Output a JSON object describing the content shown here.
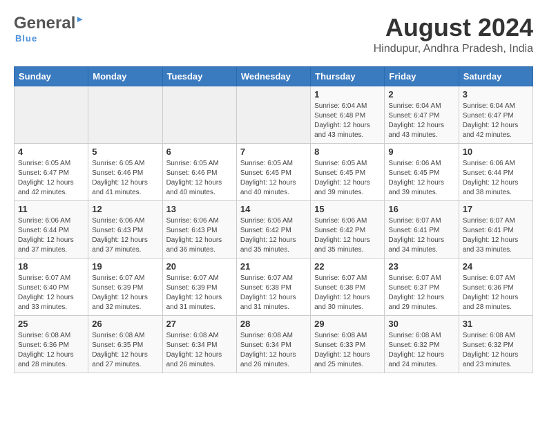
{
  "header": {
    "logo_general": "General",
    "logo_blue": "Blue",
    "month_year": "August 2024",
    "location": "Hindupur, Andhra Pradesh, India"
  },
  "calendar": {
    "weekdays": [
      "Sunday",
      "Monday",
      "Tuesday",
      "Wednesday",
      "Thursday",
      "Friday",
      "Saturday"
    ],
    "weeks": [
      [
        {
          "day": "",
          "info": ""
        },
        {
          "day": "",
          "info": ""
        },
        {
          "day": "",
          "info": ""
        },
        {
          "day": "",
          "info": ""
        },
        {
          "day": "1",
          "info": "Sunrise: 6:04 AM\nSunset: 6:48 PM\nDaylight: 12 hours\nand 43 minutes."
        },
        {
          "day": "2",
          "info": "Sunrise: 6:04 AM\nSunset: 6:47 PM\nDaylight: 12 hours\nand 43 minutes."
        },
        {
          "day": "3",
          "info": "Sunrise: 6:04 AM\nSunset: 6:47 PM\nDaylight: 12 hours\nand 42 minutes."
        }
      ],
      [
        {
          "day": "4",
          "info": "Sunrise: 6:05 AM\nSunset: 6:47 PM\nDaylight: 12 hours\nand 42 minutes."
        },
        {
          "day": "5",
          "info": "Sunrise: 6:05 AM\nSunset: 6:46 PM\nDaylight: 12 hours\nand 41 minutes."
        },
        {
          "day": "6",
          "info": "Sunrise: 6:05 AM\nSunset: 6:46 PM\nDaylight: 12 hours\nand 40 minutes."
        },
        {
          "day": "7",
          "info": "Sunrise: 6:05 AM\nSunset: 6:45 PM\nDaylight: 12 hours\nand 40 minutes."
        },
        {
          "day": "8",
          "info": "Sunrise: 6:05 AM\nSunset: 6:45 PM\nDaylight: 12 hours\nand 39 minutes."
        },
        {
          "day": "9",
          "info": "Sunrise: 6:06 AM\nSunset: 6:45 PM\nDaylight: 12 hours\nand 39 minutes."
        },
        {
          "day": "10",
          "info": "Sunrise: 6:06 AM\nSunset: 6:44 PM\nDaylight: 12 hours\nand 38 minutes."
        }
      ],
      [
        {
          "day": "11",
          "info": "Sunrise: 6:06 AM\nSunset: 6:44 PM\nDaylight: 12 hours\nand 37 minutes."
        },
        {
          "day": "12",
          "info": "Sunrise: 6:06 AM\nSunset: 6:43 PM\nDaylight: 12 hours\nand 37 minutes."
        },
        {
          "day": "13",
          "info": "Sunrise: 6:06 AM\nSunset: 6:43 PM\nDaylight: 12 hours\nand 36 minutes."
        },
        {
          "day": "14",
          "info": "Sunrise: 6:06 AM\nSunset: 6:42 PM\nDaylight: 12 hours\nand 35 minutes."
        },
        {
          "day": "15",
          "info": "Sunrise: 6:06 AM\nSunset: 6:42 PM\nDaylight: 12 hours\nand 35 minutes."
        },
        {
          "day": "16",
          "info": "Sunrise: 6:07 AM\nSunset: 6:41 PM\nDaylight: 12 hours\nand 34 minutes."
        },
        {
          "day": "17",
          "info": "Sunrise: 6:07 AM\nSunset: 6:41 PM\nDaylight: 12 hours\nand 33 minutes."
        }
      ],
      [
        {
          "day": "18",
          "info": "Sunrise: 6:07 AM\nSunset: 6:40 PM\nDaylight: 12 hours\nand 33 minutes."
        },
        {
          "day": "19",
          "info": "Sunrise: 6:07 AM\nSunset: 6:39 PM\nDaylight: 12 hours\nand 32 minutes."
        },
        {
          "day": "20",
          "info": "Sunrise: 6:07 AM\nSunset: 6:39 PM\nDaylight: 12 hours\nand 31 minutes."
        },
        {
          "day": "21",
          "info": "Sunrise: 6:07 AM\nSunset: 6:38 PM\nDaylight: 12 hours\nand 31 minutes."
        },
        {
          "day": "22",
          "info": "Sunrise: 6:07 AM\nSunset: 6:38 PM\nDaylight: 12 hours\nand 30 minutes."
        },
        {
          "day": "23",
          "info": "Sunrise: 6:07 AM\nSunset: 6:37 PM\nDaylight: 12 hours\nand 29 minutes."
        },
        {
          "day": "24",
          "info": "Sunrise: 6:07 AM\nSunset: 6:36 PM\nDaylight: 12 hours\nand 28 minutes."
        }
      ],
      [
        {
          "day": "25",
          "info": "Sunrise: 6:08 AM\nSunset: 6:36 PM\nDaylight: 12 hours\nand 28 minutes."
        },
        {
          "day": "26",
          "info": "Sunrise: 6:08 AM\nSunset: 6:35 PM\nDaylight: 12 hours\nand 27 minutes."
        },
        {
          "day": "27",
          "info": "Sunrise: 6:08 AM\nSunset: 6:34 PM\nDaylight: 12 hours\nand 26 minutes."
        },
        {
          "day": "28",
          "info": "Sunrise: 6:08 AM\nSunset: 6:34 PM\nDaylight: 12 hours\nand 26 minutes."
        },
        {
          "day": "29",
          "info": "Sunrise: 6:08 AM\nSunset: 6:33 PM\nDaylight: 12 hours\nand 25 minutes."
        },
        {
          "day": "30",
          "info": "Sunrise: 6:08 AM\nSunset: 6:32 PM\nDaylight: 12 hours\nand 24 minutes."
        },
        {
          "day": "31",
          "info": "Sunrise: 6:08 AM\nSunset: 6:32 PM\nDaylight: 12 hours\nand 23 minutes."
        }
      ]
    ]
  }
}
